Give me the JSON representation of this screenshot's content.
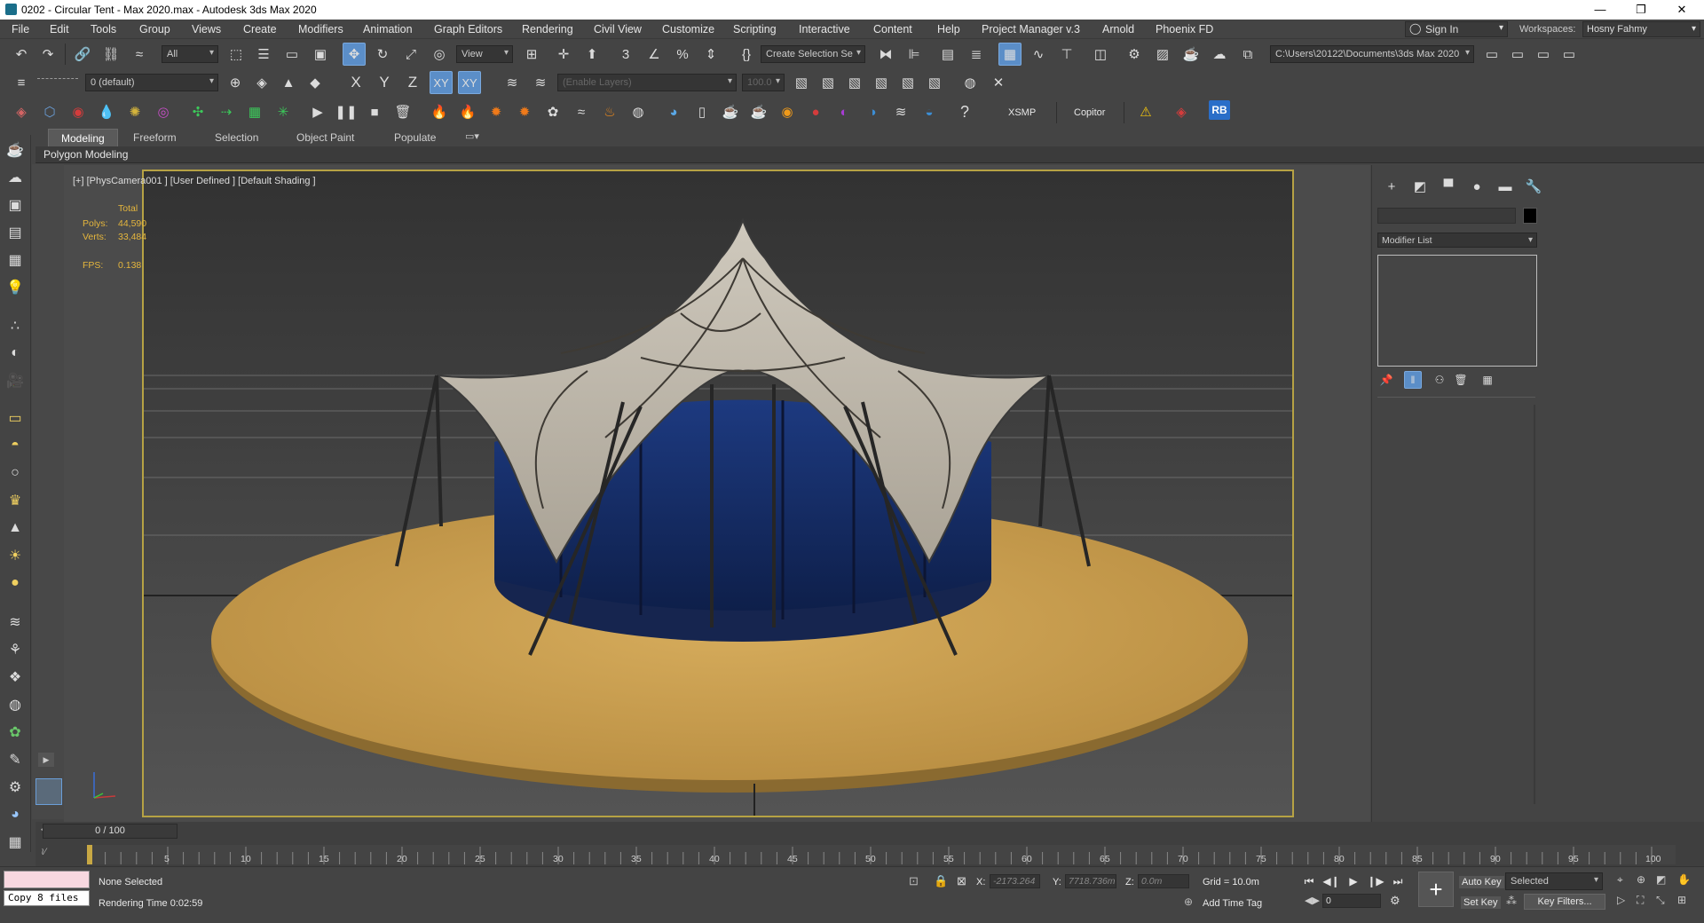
{
  "window": {
    "title": "0202 - Circular Tent - Max 2020.max - Autodesk 3ds Max 2020",
    "minimize": "—",
    "maximize": "❐",
    "close": "✕"
  },
  "menu": [
    "File",
    "Edit",
    "Tools",
    "Group",
    "Views",
    "Create",
    "Modifiers",
    "Animation",
    "Graph Editors",
    "Rendering",
    "Civil View",
    "Customize",
    "Scripting",
    "Interactive",
    "Content",
    "Help",
    "Project Manager v.3",
    "Arnold",
    "Phoenix FD"
  ],
  "signin": "Sign In",
  "workspaces": {
    "label": "Workspaces:",
    "value": "Hosny Fahmy"
  },
  "toolbar1": {
    "selection_filter": "All",
    "view_ref": "View",
    "selection_set": "Create Selection Se",
    "project_path": "C:\\Users\\20122\\Documents\\3ds Max 2020"
  },
  "toolbar2": {
    "layer": "0 (default)",
    "axis_x": "X",
    "axis_y": "Y",
    "axis_z": "Z",
    "axis_xy": "XY",
    "axis_xy2": "XY",
    "enable_layers": "(Enable Layers)",
    "percent": "100.0"
  },
  "toolbar3": {
    "xsmp": "XSMP",
    "copitor": "Copitor",
    "rb": "RB"
  },
  "ribbon": {
    "tabs": [
      "Modeling",
      "Freeform",
      "Selection",
      "Object Paint",
      "Populate"
    ],
    "panel": "Polygon Modeling"
  },
  "viewport": {
    "label": "[+] [PhysCamera001 ] [User Defined ] [Default Shading ]",
    "stats": {
      "total_label": "Total",
      "polys_label": "Polys:",
      "polys": "44,590",
      "verts_label": "Verts:",
      "verts": "33,484",
      "fps_label": "FPS:",
      "fps": "0.138"
    }
  },
  "command_panel": {
    "modifier_list": "Modifier List"
  },
  "timeline": {
    "frame": "0 / 100",
    "ticks": [
      "5",
      "10",
      "15",
      "20",
      "25",
      "30",
      "35",
      "40",
      "45",
      "50",
      "55",
      "60",
      "65",
      "70",
      "75",
      "80",
      "85",
      "90",
      "95",
      "100"
    ]
  },
  "status": {
    "script_output": "Copy 8 files",
    "selection": "None Selected",
    "rendering_time": "Rendering Time  0:02:59",
    "x_label": "X:",
    "x": "-2173.264",
    "y_label": "Y:",
    "y": "7718.736m",
    "z_label": "Z:",
    "z": "0.0m",
    "grid": "Grid = 10.0m",
    "add_time_tag": "Add Time Tag",
    "auto_key": "Auto Key",
    "selected": "Selected",
    "set_key": "Set Key",
    "key_filters": "Key Filters...",
    "frame_value": "0"
  }
}
